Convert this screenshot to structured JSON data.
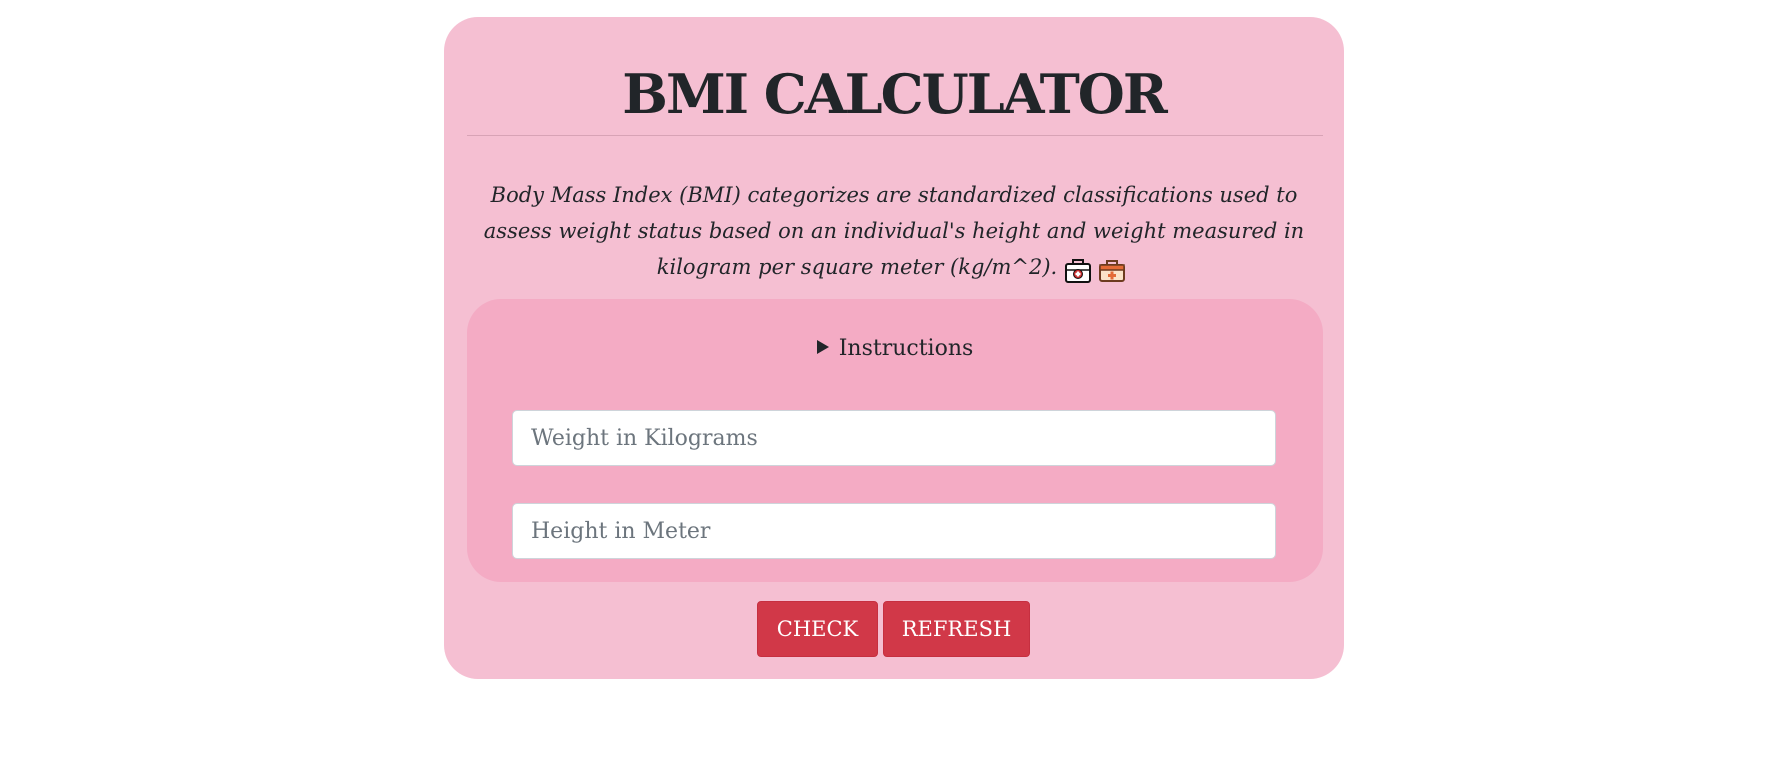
{
  "page": {
    "title": "BMI CALCULATOR",
    "description": "Body Mass Index (BMI) categorizes are standardized classifications used to assess weight status based on an individual's height and weight measured in kilogram per square meter (kg/m^2).",
    "description_icons": [
      "medical-kit-icon",
      "first-aid-box-icon"
    ]
  },
  "instructions": {
    "label": "Instructions",
    "expanded": false
  },
  "form": {
    "weight_placeholder": "Weight in Kilograms",
    "weight_value": "",
    "height_placeholder": "Height in Meter",
    "height_value": ""
  },
  "buttons": {
    "check_label": "CHECK",
    "refresh_label": "REFRESH"
  },
  "colors": {
    "card_background": "#f5bfd2",
    "inner_panel_background": "#f4abc4",
    "button_background": "#d13848",
    "text": "#212529"
  }
}
